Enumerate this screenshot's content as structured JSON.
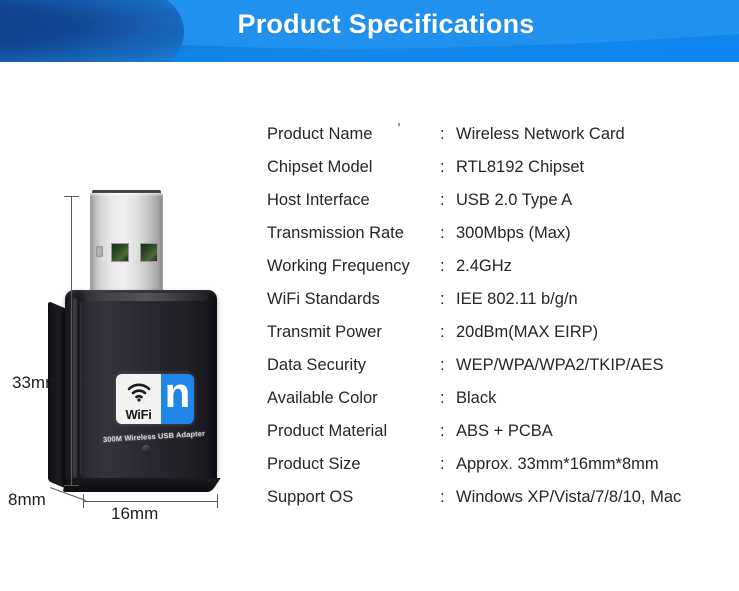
{
  "header": {
    "title": "Product Specifications",
    "banner_color": "#2191f0",
    "pill_color": "#11458f",
    "title_color": "#ffffff"
  },
  "product_image": {
    "alt": "300M Wireless USB Adapter",
    "device_caption": "300M Wireless USB Adapter",
    "logo": {
      "wifi_text": "WiFi",
      "standard_letter": "n",
      "badge_blue": "#1f86e8"
    },
    "dimensions": {
      "height": "33mm",
      "depth": "8mm",
      "width": "16mm"
    }
  },
  "specs": {
    "separator": ":",
    "rows": [
      {
        "label": "Product Name",
        "value": "Wireless Network Card"
      },
      {
        "label": "Chipset Model",
        "value": "RTL8192 Chipset"
      },
      {
        "label": "Host Interface",
        "value": "USB 2.0 Type A"
      },
      {
        "label": "Transmission Rate",
        "value": "300Mbps (Max)"
      },
      {
        "label": "Working Frequency",
        "value": "2.4GHz"
      },
      {
        "label": "WiFi Standards",
        "value": "IEE 802.11 b/g/n"
      },
      {
        "label": "Transmit Power",
        "value": "20dBm(MAX EIRP)"
      },
      {
        "label": "Data Security",
        "value": "WEP/WPA/WPA2/TKIP/AES"
      },
      {
        "label": "Available Color",
        "value": "Black"
      },
      {
        "label": "Product Material",
        "value": "ABS + PCBA"
      },
      {
        "label": "Product Size",
        "value": "Approx. 33mm*16mm*8mm"
      },
      {
        "label": "Support OS",
        "value": "Windows XP/Vista/7/8/10, Mac"
      }
    ]
  }
}
